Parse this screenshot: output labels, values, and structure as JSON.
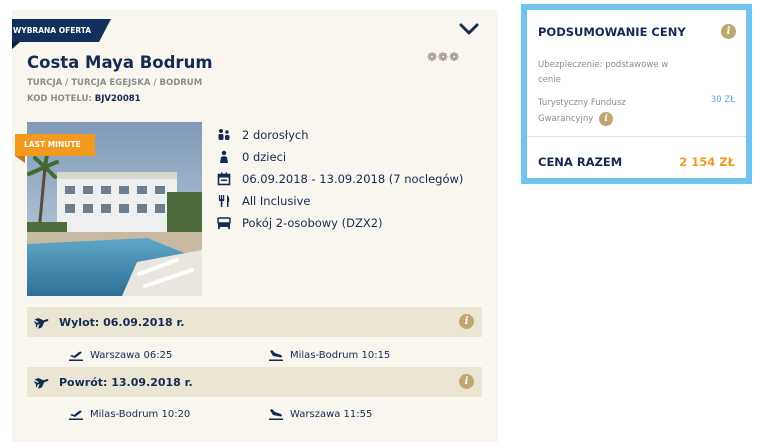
{
  "offer": {
    "badge": "WYBRANA OFERTA",
    "hotel_name": "Costa Maya Bodrum",
    "stars_glyph": "❁❁❁",
    "location": "TURCJA / TURCJA EGEJSKA / BODRUM",
    "hotel_code_label": "KOD HOTELU:",
    "hotel_code": "BJV20081",
    "photo_badge": "LAST MINUTE",
    "details": {
      "adults": "2 dorosłych",
      "children": "0 dzieci",
      "dates": "06.09.2018 - 13.09.2018 (7 noclegów)",
      "board": "All Inclusive",
      "room": "Pokój 2-osobowy (DZX2)"
    },
    "icons": {
      "adults": "people-icon",
      "children": "person-icon",
      "dates": "calendar-icon",
      "board": "cutlery-icon",
      "room": "bed-icon",
      "expand": "chevron-down-icon",
      "flight": "airplane-icon",
      "takeoff": "plane-takeoff-icon",
      "landing": "plane-landing-icon",
      "info": "info-icon"
    }
  },
  "flights": {
    "outbound": {
      "label": "Wylot: 06.09.2018 r.",
      "departure": "Warszawa 06:25",
      "arrival": "Milas-Bodrum 10:15"
    },
    "return": {
      "label": "Powrót: 13.09.2018 r.",
      "departure": "Milas-Bodrum 10:20",
      "arrival": "Warszawa 11:55"
    }
  },
  "summary": {
    "title": "PODSUMOWANIE CENY",
    "insurance": "Ubezpieczenie: podstawowe w cenie",
    "tfg_label": "Turystyczny Fundusz Gwarancyjny",
    "tfg_value": "30 ZŁ",
    "total_label": "CENA RAZEM",
    "total_value": "2 154 ZŁ"
  },
  "info_glyph": "i",
  "colors": {
    "navy": "#142a52",
    "accent_orange": "#f29a1f",
    "summary_border": "#6ec3ef",
    "card_bg": "#f9f6ef",
    "flight_bar": "#ebe6d4",
    "info_gold": "#bfa770"
  }
}
